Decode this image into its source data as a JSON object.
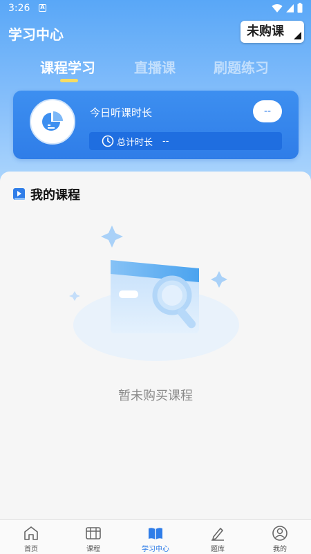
{
  "status_bar": {
    "time": "3:26",
    "notification_letter": "A"
  },
  "header": {
    "title": "学习中心",
    "purchase_button": "未购课"
  },
  "tabs": [
    {
      "label": "课程学习",
      "active": true
    },
    {
      "label": "直播课",
      "active": false
    },
    {
      "label": "刷题练习",
      "active": false
    }
  ],
  "stats": {
    "today_label": "今日听课时长",
    "today_value": "--",
    "total_label": "总计时长",
    "total_value": "--"
  },
  "section": {
    "title": "我的课程",
    "empty_text": "暂未购买课程"
  },
  "bottom_nav": [
    {
      "label": "首页",
      "icon": "home-icon",
      "active": false
    },
    {
      "label": "课程",
      "icon": "course-icon",
      "active": false
    },
    {
      "label": "学习中心",
      "icon": "study-center-icon",
      "active": true
    },
    {
      "label": "题库",
      "icon": "question-bank-icon",
      "active": false
    },
    {
      "label": "我的",
      "icon": "profile-icon",
      "active": false
    }
  ],
  "colors": {
    "accent": "#2f7de8",
    "header_gradient_top": "#59a7f7",
    "tab_indicator": "#f6dc63",
    "empty_text": "#8a8a8a"
  }
}
